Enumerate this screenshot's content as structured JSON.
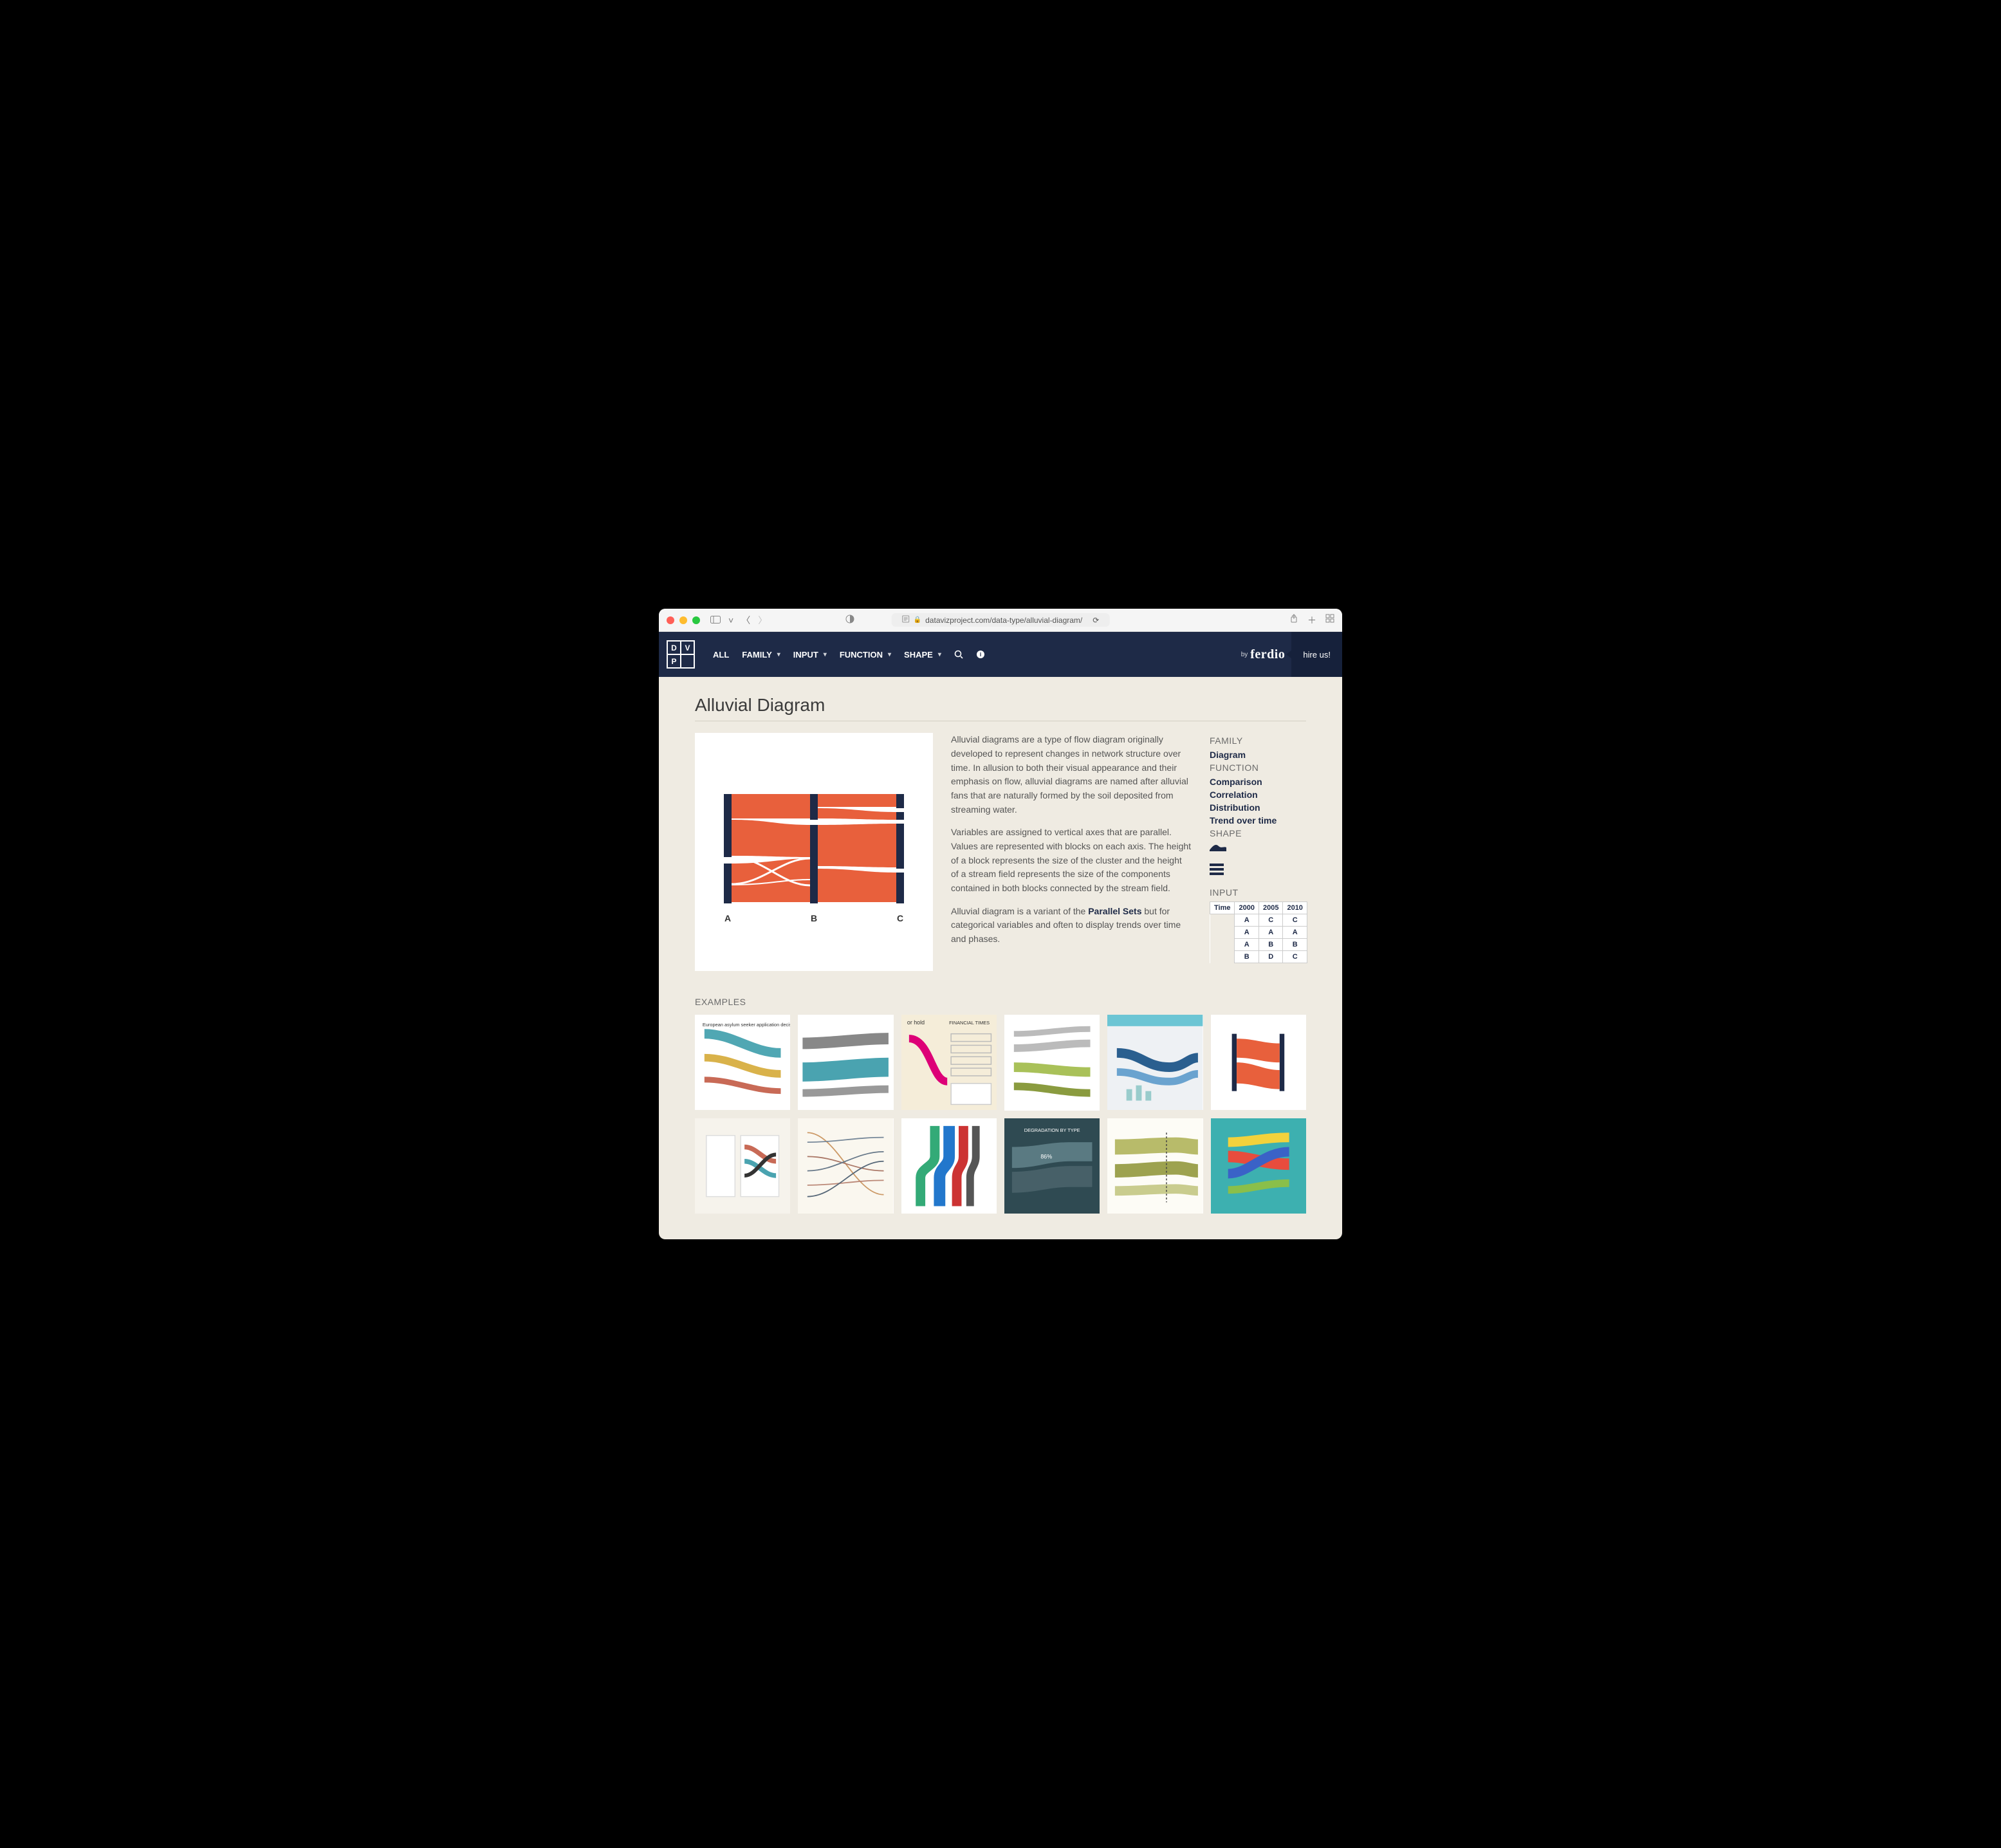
{
  "browser": {
    "url": "datavizproject.com/data-type/alluvial-diagram/"
  },
  "nav": {
    "all": "ALL",
    "family": "FAMILY",
    "input": "INPUT",
    "function": "FUNCTION",
    "shape": "SHAPE",
    "by": "by",
    "brand": "ferdio",
    "hire": "hire us!"
  },
  "page": {
    "title": "Alluvial Diagram",
    "p1": "Alluvial diagrams are a type of flow diagram originally developed to represent changes in network structure over time. In allusion to both their visual appearance and their emphasis on flow, alluvial diagrams are named after alluvial fans that are naturally formed by the soil deposited from streaming water.",
    "p2": "Variables are assigned to vertical axes that are parallel. Values are represented with blocks on each axis. The height of a block represents the size of the cluster and the height of a stream field represents the size of the components contained in both blocks connected by the stream field.",
    "p3a": "Alluvial diagram is a variant of the ",
    "p3link": "Parallel Sets",
    "p3b": " but for categorical variables and often to display trends over time and phases."
  },
  "hero_axes": {
    "a": "A",
    "b": "B",
    "c": "C"
  },
  "sidebar": {
    "family_label": "FAMILY",
    "family_link": "Diagram",
    "function_label": "FUNCTION",
    "functions": [
      "Comparison",
      "Correlation",
      "Distribution",
      "Trend over time"
    ],
    "shape_label": "SHAPE",
    "input_label": "INPUT",
    "table": {
      "header": [
        "Time",
        "2000",
        "2005",
        "2010"
      ],
      "rows": [
        [
          "",
          "A",
          "C",
          "C"
        ],
        [
          "",
          "A",
          "A",
          "A"
        ],
        [
          "",
          "A",
          "B",
          "B"
        ],
        [
          "",
          "B",
          "D",
          "C"
        ]
      ]
    }
  },
  "examples_label": "EXAMPLES"
}
